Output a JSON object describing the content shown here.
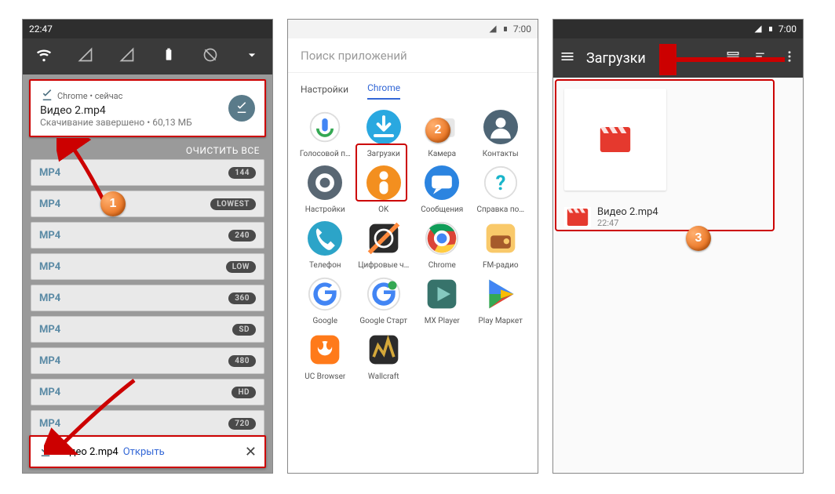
{
  "phone1": {
    "time": "22:47",
    "notif": {
      "source": "Chrome • сейчас",
      "title": "Видео 2.mp4",
      "subtitle": "Скачивание завершено • 60,13 МБ"
    },
    "clear_all": "ОЧИСТИТЬ ВСЕ",
    "rows": [
      {
        "fmt": "MP4",
        "badge": "144"
      },
      {
        "fmt": "MP4",
        "badge": "LOWEST"
      },
      {
        "fmt": "MP4",
        "badge": "240"
      },
      {
        "fmt": "MP4",
        "badge": "LOW"
      },
      {
        "fmt": "MP4",
        "badge": "360"
      },
      {
        "fmt": "MP4",
        "badge": "SD"
      },
      {
        "fmt": "MP4",
        "badge": "480"
      },
      {
        "fmt": "MP4",
        "badge": "HD"
      },
      {
        "fmt": "MP4",
        "badge": "720"
      }
    ],
    "snackbar": {
      "file": "Видео 2.mp4",
      "open": "Открыть"
    }
  },
  "phone2": {
    "status_time": "7:00",
    "search_placeholder": "Поиск приложений",
    "tab1": "Настройки",
    "tab2": "Chrome",
    "apps": [
      {
        "name": "Голосовой п…",
        "bg": "#ffffff",
        "glyph": "voice"
      },
      {
        "name": "Загрузки",
        "bg": "#2aa8e0",
        "glyph": "download"
      },
      {
        "name": "Камера",
        "bg": "#ffffff",
        "glyph": "camera"
      },
      {
        "name": "Контакты",
        "bg": "#4e6575",
        "glyph": "contacts"
      },
      {
        "name": "Настройки",
        "bg": "#596773",
        "glyph": "gear"
      },
      {
        "name": "OK",
        "bg": "#f38f1f",
        "glyph": "ok"
      },
      {
        "name": "Сообщения",
        "bg": "#2b84e0",
        "glyph": "message"
      },
      {
        "name": "Справка по…",
        "bg": "#ffffff",
        "glyph": "help"
      },
      {
        "name": "Телефон",
        "bg": "#2ca4c8",
        "glyph": "phone"
      },
      {
        "name": "Цифровые ч…",
        "bg": "#ffffff",
        "glyph": "clock"
      },
      {
        "name": "Chrome",
        "bg": "#ffffff",
        "glyph": "chrome"
      },
      {
        "name": "FM-радио",
        "bg": "#f9c96a",
        "glyph": "radio"
      },
      {
        "name": "Google",
        "bg": "#ffffff",
        "glyph": "google"
      },
      {
        "name": "Google Старт",
        "bg": "#ffffff",
        "glyph": "gstart"
      },
      {
        "name": "MX Player",
        "bg": "#37736b",
        "glyph": "mx"
      },
      {
        "name": "Play Маркет",
        "bg": "#ffffff",
        "glyph": "play"
      },
      {
        "name": "UC Browser",
        "bg": "#ff7a1a",
        "glyph": "uc"
      },
      {
        "name": "Wallcraft",
        "bg": "#2b2b2b",
        "glyph": "wall"
      }
    ]
  },
  "phone3": {
    "status_time": "7:00",
    "title": "Загрузки",
    "file": {
      "name": "Видео 2.mp4",
      "time": "22:47"
    }
  }
}
